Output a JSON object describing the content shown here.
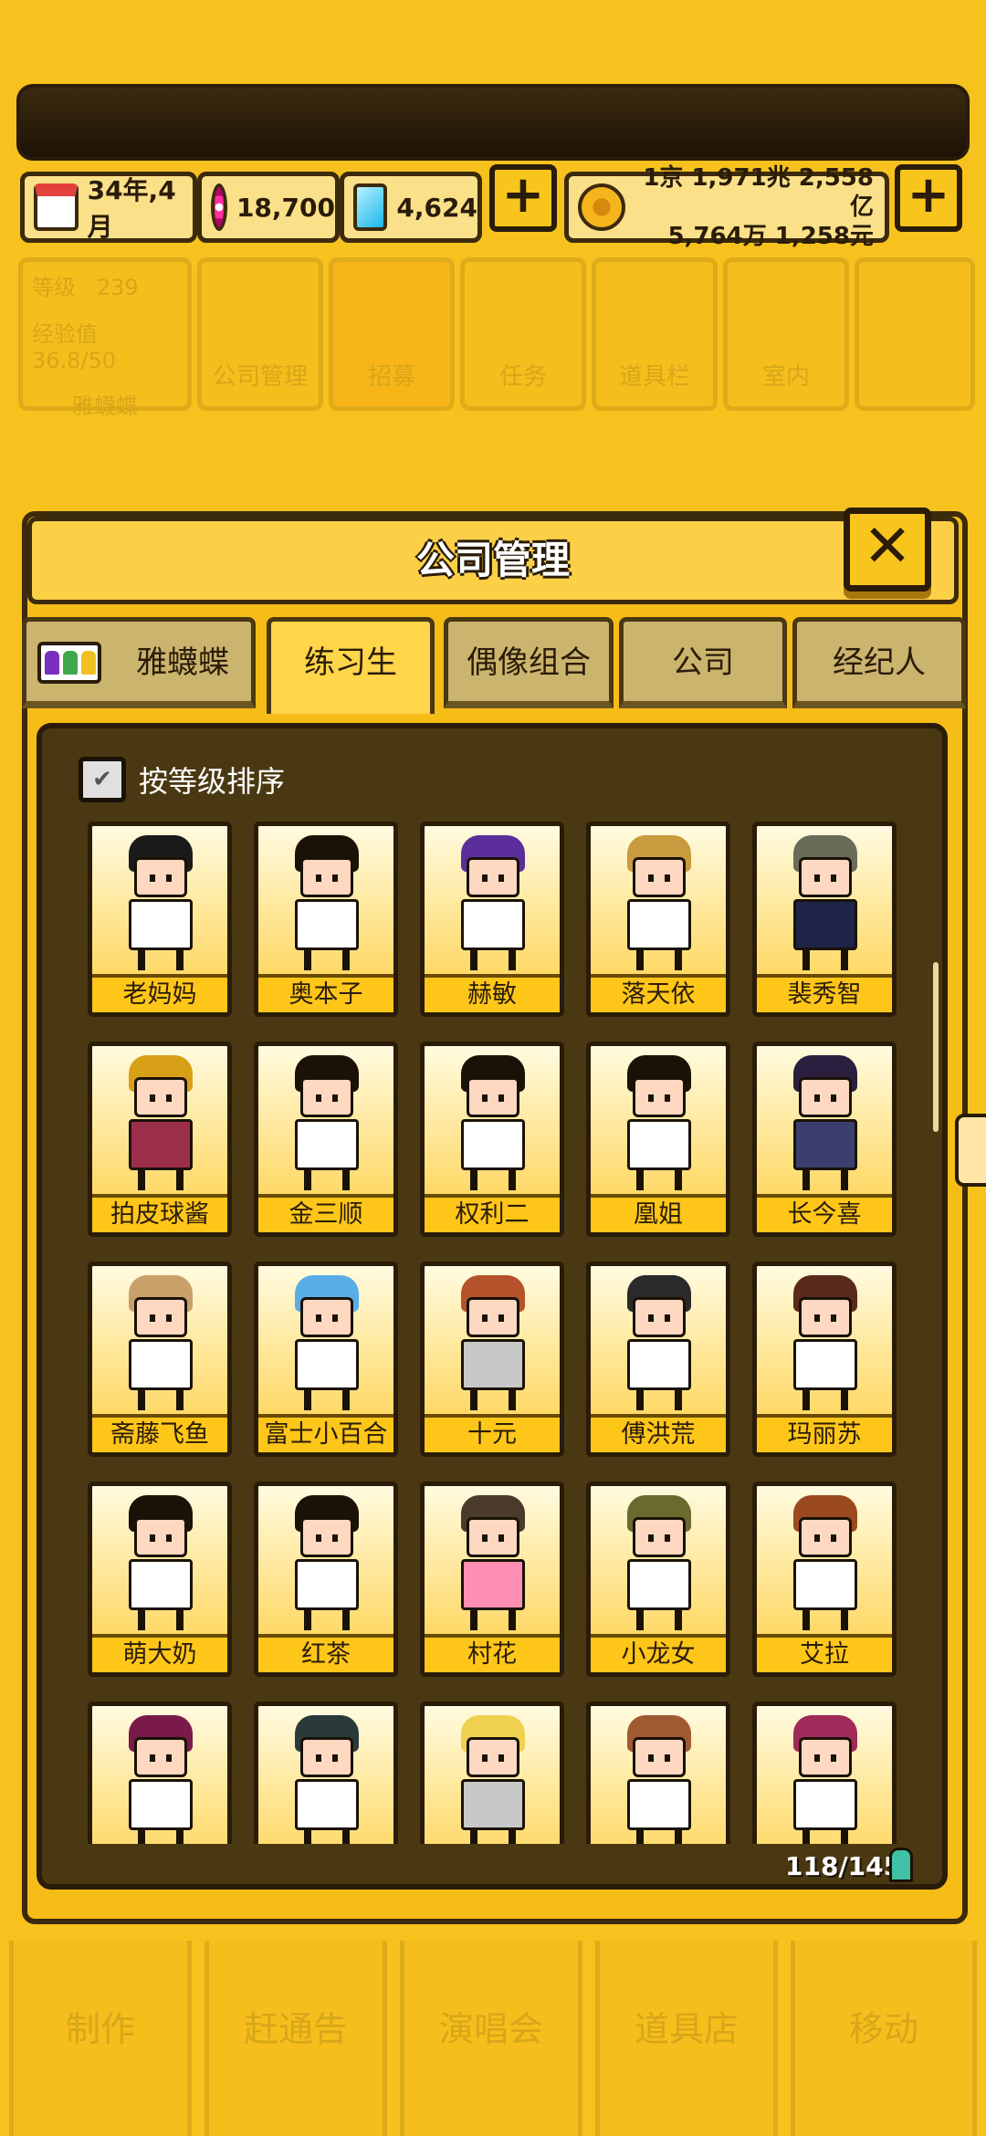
{
  "status": {
    "date": "34年,4月",
    "pink_currency": "18,700",
    "gem_currency": "4,624",
    "money_line1": "1京 1,971兆 2,558亿",
    "money_line2": "5,764万 1,258元",
    "add_label": "+"
  },
  "menu": {
    "level_label": "等级",
    "level_value": "239",
    "exp_label": "经验值",
    "exp_value": "36.8/50",
    "company_name": "雅蠛蝶",
    "items": [
      "公司管理",
      "招募",
      "任务",
      "道具栏",
      "室内"
    ]
  },
  "bottom_nav": [
    "制作",
    "赶通告",
    "演唱会",
    "道具店",
    "移动"
  ],
  "panel": {
    "title": "公司管理",
    "close_label": "✕",
    "tabs": [
      "雅蠛蝶",
      "练习生",
      "偶像组合",
      "公司",
      "经纪人"
    ],
    "active_tab": "练习生",
    "sort_label": "按等级排序",
    "checkbox_mark": "✔",
    "count": "118/145"
  },
  "trainees": [
    {
      "name": "老妈妈",
      "hair": "#1a1a1a",
      "shirt": "#ffffff"
    },
    {
      "name": "奥本子",
      "hair": "#1a1206",
      "shirt": "#ffffff"
    },
    {
      "name": "赫敏",
      "hair": "#5b2d9a",
      "shirt": "#ffffff"
    },
    {
      "name": "落天依",
      "hair": "#c99b3e",
      "shirt": "#ffffff"
    },
    {
      "name": "裴秀智",
      "hair": "#6b6b5a",
      "shirt": "#1e2447"
    },
    {
      "name": "拍皮球酱",
      "hair": "#d8a017",
      "shirt": "#9b2e4a"
    },
    {
      "name": "金三顺",
      "hair": "#1a1206",
      "shirt": "#ffffff"
    },
    {
      "name": "权利二",
      "hair": "#1a1206",
      "shirt": "#ffffff"
    },
    {
      "name": "凰姐",
      "hair": "#1a1206",
      "shirt": "#ffffff"
    },
    {
      "name": "长今喜",
      "hair": "#2a1f3e",
      "shirt": "#3a3f6e"
    },
    {
      "name": "斋藤飞鱼",
      "hair": "#c8a06a",
      "shirt": "#ffffff"
    },
    {
      "name": "富士小百合",
      "hair": "#5aaee8",
      "shirt": "#ffffff"
    },
    {
      "name": "十元",
      "hair": "#b4532a",
      "shirt": "#c8c8c8"
    },
    {
      "name": "傅洪荒",
      "hair": "#2a2a2a",
      "shirt": "#ffffff"
    },
    {
      "name": "玛丽苏",
      "hair": "#5a2a1a",
      "shirt": "#ffffff"
    },
    {
      "name": "萌大奶",
      "hair": "#1a1206",
      "shirt": "#ffffff"
    },
    {
      "name": "红茶",
      "hair": "#1a1206",
      "shirt": "#ffffff"
    },
    {
      "name": "村花",
      "hair": "#4a3a2a",
      "shirt": "#ff8fb4"
    },
    {
      "name": "小龙女",
      "hair": "#6a6a2e",
      "shirt": "#ffffff"
    },
    {
      "name": "艾拉",
      "hair": "#9a4a1e",
      "shirt": "#ffffff"
    },
    {
      "name": "",
      "hair": "#7a1a4a",
      "shirt": "#ffffff"
    },
    {
      "name": "",
      "hair": "#2a3a3a",
      "shirt": "#ffffff"
    },
    {
      "name": "",
      "hair": "#f0d050",
      "shirt": "#c8c8c8"
    },
    {
      "name": "",
      "hair": "#a05a32",
      "shirt": "#ffffff"
    },
    {
      "name": "",
      "hair": "#a02a5a",
      "shirt": "#ffffff"
    }
  ]
}
